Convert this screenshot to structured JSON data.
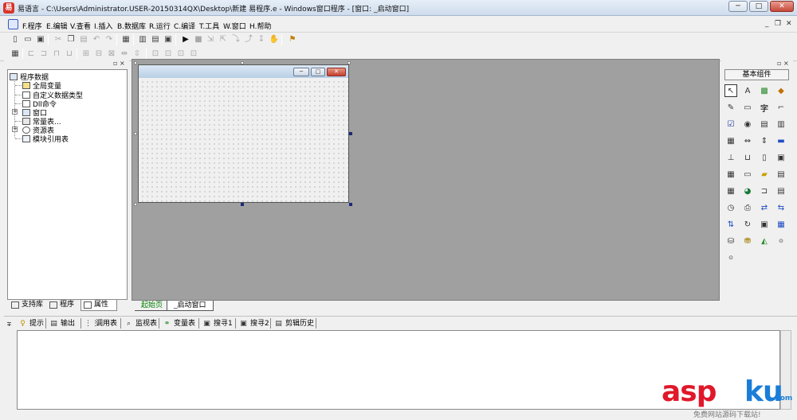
{
  "window": {
    "app_icon": "app-logo-icon",
    "title": "易语言 - C:\\Users\\Administrator.USER-20150314QX\\Desktop\\新建 易程序.e - Windows窗口程序 - [窗口: _启动窗口]",
    "minimize": "─",
    "maximize": "□",
    "close": "✕"
  },
  "menu": {
    "items": [
      "F.程序",
      "E.编辑",
      "V.查看",
      "I.插入",
      "B.数据库",
      "R.运行",
      "C.编译",
      "T.工具",
      "W.窗口",
      "H.帮助"
    ],
    "mdi_min": "_",
    "mdi_restore": "❐",
    "mdi_close": "✕"
  },
  "toolbar1": {
    "buttons": [
      "new-file-icon",
      "open-file-icon",
      "save-icon",
      "cut-icon",
      "copy-icon",
      "paste-icon",
      "undo-icon",
      "redo-icon",
      "find-icon",
      "layout-1-icon",
      "layout-2-icon",
      "layout-3-icon",
      "run-icon",
      "stop-icon",
      "step-1-icon",
      "step-2-icon",
      "step-3-icon",
      "step-4-icon",
      "hand-icon",
      "debug-icon"
    ]
  },
  "toolbar2": {
    "buttons": [
      "align-left-icon",
      "align-center-icon",
      "align-right-icon",
      "align-top-icon",
      "align-middle-icon",
      "align-bottom-icon",
      "same-width-icon",
      "same-height-icon",
      "same-size-icon",
      "h-space-icon",
      "v-space-icon",
      "center-h-icon",
      "center-v-icon"
    ]
  },
  "left_panel": {
    "header_controls": "▫ ×",
    "tree": {
      "root": "程序数据",
      "items": [
        {
          "label": "全局变量",
          "icon": "global-var-icon",
          "expandable": false
        },
        {
          "label": "自定义数据类型",
          "icon": "custom-type-icon",
          "expandable": false
        },
        {
          "label": "Dll命令",
          "icon": "dll-icon",
          "expandable": false
        },
        {
          "label": "窗口",
          "icon": "window-icon",
          "expandable": true
        },
        {
          "label": "常量表...",
          "icon": "constant-icon",
          "expandable": false
        },
        {
          "label": "资源表",
          "icon": "resource-icon",
          "expandable": true
        },
        {
          "label": "模块引用表",
          "icon": "module-icon",
          "expandable": false
        }
      ]
    },
    "tabs": [
      "支持库",
      "程序",
      "属性"
    ],
    "active_tab": 2
  },
  "design": {
    "form_buttons": [
      "─",
      "□",
      "✕"
    ],
    "tabs": [
      "起始页",
      "_启动窗口"
    ]
  },
  "right_panel": {
    "header_controls": "▫ ×",
    "header": "基本组件",
    "components": [
      "pointer-icon",
      "label-icon",
      "picture-icon",
      "shape-icon",
      "edit-icon",
      "button-icon",
      "text-icon",
      "frame-icon",
      "checkbox-icon",
      "radio-icon",
      "listbox-icon",
      "combobox-icon",
      "grid-icon",
      "hscroll-icon",
      "vscroll-icon",
      "progress-icon",
      "line-icon",
      "slider-icon",
      "tab-icon",
      "image-list-icon",
      "table-icon",
      "rect-icon",
      "folder-icon",
      "dir-icon",
      "calendar-icon",
      "web-icon",
      "tree-icon",
      "list-icon",
      "timer-icon",
      "printer-icon",
      "data-nav-icon",
      "data-link-icon",
      "db-provider-icon",
      "sync-icon",
      "file-icon",
      "form-icon",
      "odbc-db-icon",
      "odbc-link-icon",
      "chart-icon",
      "odbc-icon",
      "odbc-table-icon"
    ]
  },
  "bottom": {
    "tabs": [
      {
        "label": "提示",
        "icon": "hint-icon"
      },
      {
        "label": "输出",
        "icon": "output-icon"
      },
      {
        "label": "调用表",
        "icon": "call-table-icon"
      },
      {
        "label": "监视表",
        "icon": "watch-icon"
      },
      {
        "label": "变量表",
        "icon": "variable-icon"
      },
      {
        "label": "搜寻1",
        "icon": "search1-icon"
      },
      {
        "label": "搜寻2",
        "icon": "search2-icon"
      },
      {
        "label": "剪辑历史",
        "icon": "clip-history-icon"
      }
    ],
    "pin": "∓"
  },
  "watermark": {
    "asp": "asp",
    "ku": "ku",
    "dotcom": ".com",
    "sub": "免费网站源码下载站!"
  },
  "colors": {
    "design_bg": "#a0a0a0",
    "watermark_red": "#e0182a",
    "watermark_blue": "#1a7dd8",
    "start_tab_green": "#008000"
  }
}
